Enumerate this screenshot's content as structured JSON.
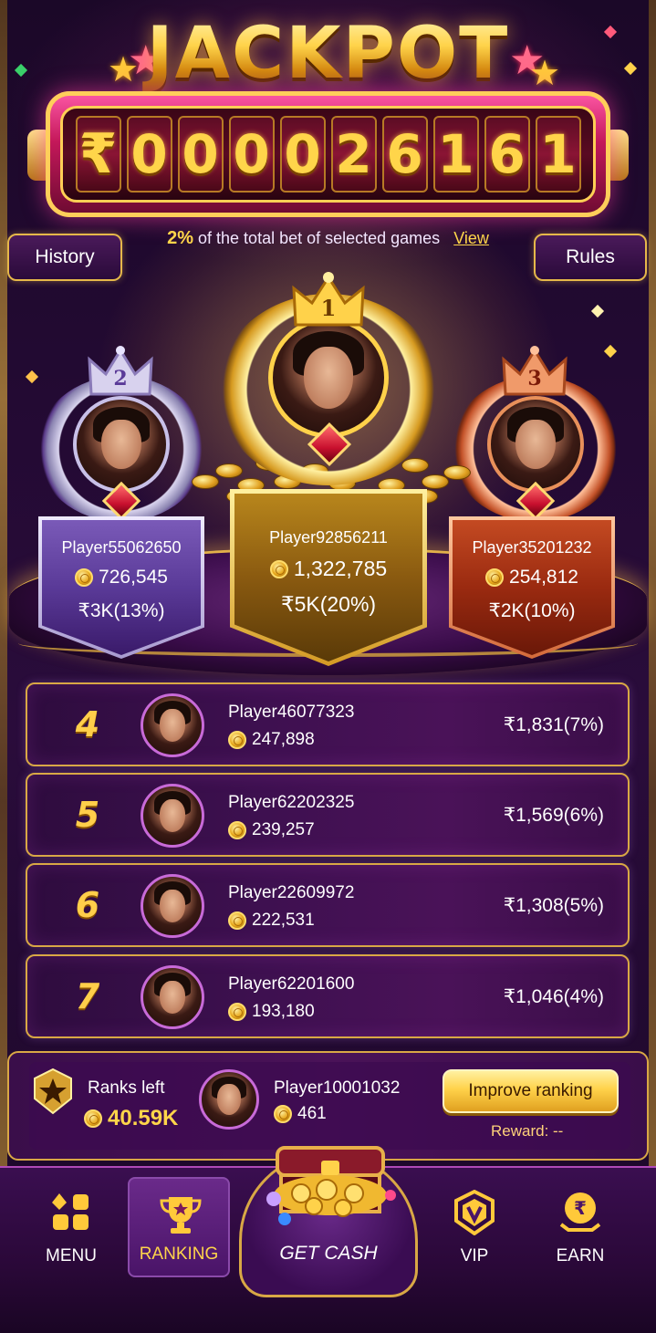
{
  "header": {
    "title": "JACKPOT",
    "counter_digits": [
      "₹",
      "0",
      "0",
      "0",
      "0",
      "2",
      "6",
      "1",
      "6",
      "1"
    ],
    "subtitle_pct": "2%",
    "subtitle_text": "of the total bet of selected games",
    "view_link": "View",
    "history_label": "History",
    "rules_label": "Rules"
  },
  "podium": [
    {
      "rank": "2",
      "name": "Player55062650",
      "coins": "726,545",
      "reward": "₹3K(13%)",
      "tier": "silver"
    },
    {
      "rank": "1",
      "name": "Player92856211",
      "coins": "1,322,785",
      "reward": "₹5K(20%)",
      "tier": "gold"
    },
    {
      "rank": "3",
      "name": "Player35201232",
      "coins": "254,812",
      "reward": "₹2K(10%)",
      "tier": "bronze"
    }
  ],
  "ranks": [
    {
      "rank": "4",
      "name": "Player46077323",
      "coins": "247,898",
      "reward": "₹1,831(7%)"
    },
    {
      "rank": "5",
      "name": "Player62202325",
      "coins": "239,257",
      "reward": "₹1,569(6%)"
    },
    {
      "rank": "6",
      "name": "Player22609972",
      "coins": "222,531",
      "reward": "₹1,308(5%)"
    },
    {
      "rank": "7",
      "name": "Player62201600",
      "coins": "193,180",
      "reward": "₹1,046(4%)"
    }
  ],
  "me": {
    "ranks_left_label": "Ranks left",
    "ranks_left_value": "40.59K",
    "name": "Player10001032",
    "coins": "461",
    "improve_label": "Improve ranking",
    "reward_text": "Reward: --"
  },
  "nav": {
    "menu": "MENU",
    "ranking": "RANKING",
    "get_cash": "GET CASH",
    "vip": "VIP",
    "earn": "EARN"
  },
  "colors": {
    "accent_gold": "#ffd54a",
    "panel_purple": "#3e1050",
    "border_gold": "#d9a845"
  }
}
